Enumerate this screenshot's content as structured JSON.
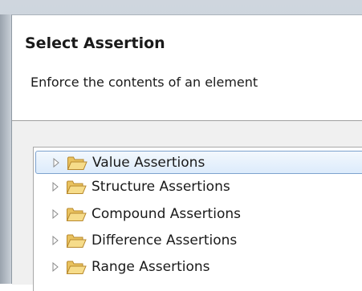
{
  "dialog": {
    "title": "Select Assertion",
    "description": "Enforce the contents of an element"
  },
  "tree": {
    "items": [
      {
        "label": "Value Assertions",
        "selected": true,
        "icon": "folder-open-icon"
      },
      {
        "label": "Structure Assertions",
        "selected": false,
        "icon": "folder-open-icon"
      },
      {
        "label": "Compound Assertions",
        "selected": false,
        "icon": "folder-open-icon"
      },
      {
        "label": "Difference Assertions",
        "selected": false,
        "icon": "folder-open-icon"
      },
      {
        "label": "Range Assertions",
        "selected": false,
        "icon": "folder-open-icon"
      }
    ]
  },
  "colors": {
    "selection_border": "#7da2ce",
    "selection_fill": "#dcebfb",
    "folder_fill": "#f3d77d",
    "folder_stroke": "#b8892e"
  }
}
